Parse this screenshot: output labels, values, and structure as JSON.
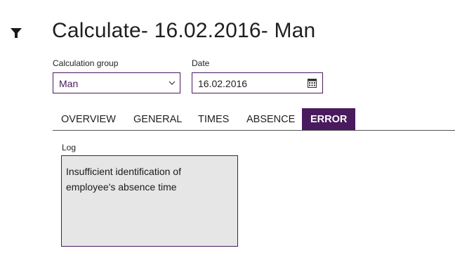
{
  "header": {
    "title": "Calculate- 16.02.2016- Man",
    "filter_icon": "filter-icon"
  },
  "form": {
    "calc_group_label": "Calculation group",
    "calc_group_value": "Man",
    "date_label": "Date",
    "date_value": "16.02.2016",
    "chevron_icon": "chevron-down-icon",
    "calendar_icon": "calendar-icon"
  },
  "tabs": [
    {
      "label": "OVERVIEW",
      "active": false
    },
    {
      "label": "GENERAL",
      "active": false
    },
    {
      "label": "TIMES",
      "active": false
    },
    {
      "label": "ABSENCE",
      "active": false
    },
    {
      "label": "ERROR",
      "active": true
    }
  ],
  "log": {
    "label": "Log",
    "text": "Insufficient identification of employee's absence time"
  },
  "colors": {
    "accent": "#4a1a5e",
    "log_background": "#e6e6e6"
  }
}
